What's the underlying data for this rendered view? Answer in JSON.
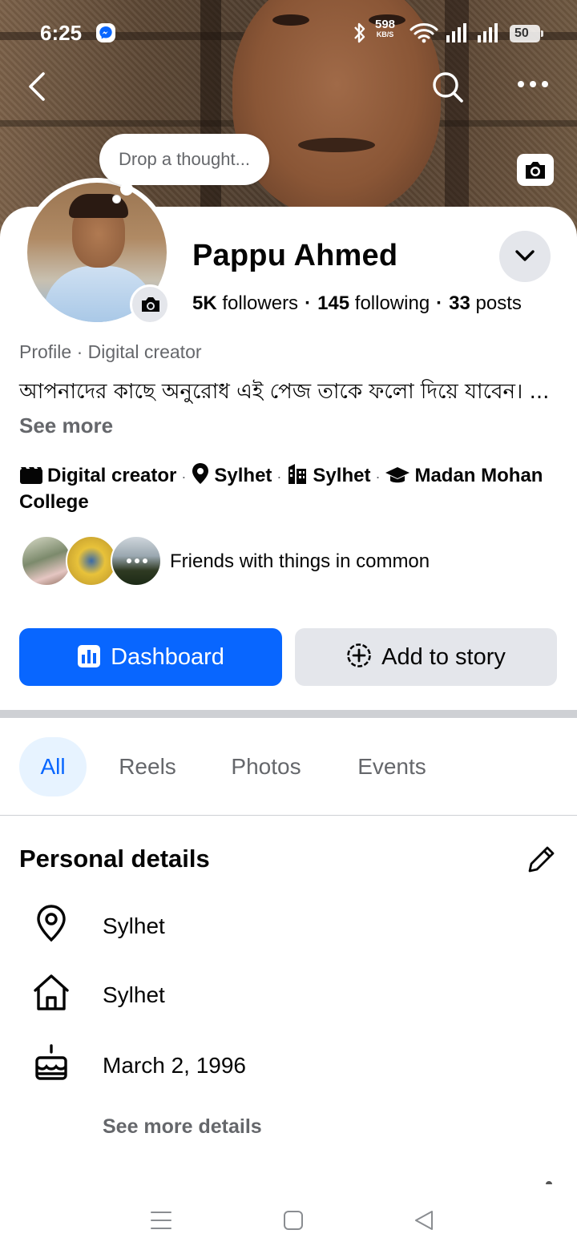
{
  "status_bar": {
    "time": "6:25",
    "net_speed_value": "598",
    "net_speed_unit": "KB/S",
    "battery": "50"
  },
  "profile": {
    "thought_prompt": "Drop a thought...",
    "name": "Pappu Ahmed",
    "followers_count": "5K",
    "followers_label": "followers",
    "following_count": "145",
    "following_label": "following",
    "posts_count": "33",
    "posts_label": "posts",
    "category": "Profile · Digital creator",
    "bio": "আপনাদের কাছে অনুরোধ  এই পেজ তাকে ফলো দিয়ে যাবেন। ... ",
    "bio_more": "See more"
  },
  "intro": {
    "digital_creator": "Digital creator",
    "location": "Sylhet",
    "work": "Sylhet",
    "education": "Madan Mohan College"
  },
  "friends": {
    "label": "Friends with things in common"
  },
  "actions": {
    "dashboard": "Dashboard",
    "add_to_story": "Add to story"
  },
  "tabs": [
    "All",
    "Reels",
    "Photos",
    "Events"
  ],
  "personal_details": {
    "title": "Personal details",
    "location": "Sylhet",
    "hometown": "Sylhet",
    "birthday": "March 2, 1996",
    "see_more": "See more details"
  },
  "colors": {
    "primary": "#0866ff",
    "secondary_bg": "#e4e6eb",
    "muted_text": "#65676b",
    "active_tab_bg": "#e7f3ff"
  },
  "icons": {
    "back": "arrow-left-icon",
    "search": "search-icon",
    "more": "more-dots-icon",
    "cover_camera": "camera-icon",
    "avatar_camera": "camera-icon",
    "dropdown": "chevron-down-icon",
    "digital_creator": "clapperboard-icon",
    "location": "map-pin-icon",
    "work": "building-icon",
    "education": "graduation-cap-icon",
    "dashboard": "bar-chart-icon",
    "add_story": "plus-circle-icon",
    "edit": "pencil-icon",
    "home": "house-icon",
    "birthday": "cake-icon"
  }
}
